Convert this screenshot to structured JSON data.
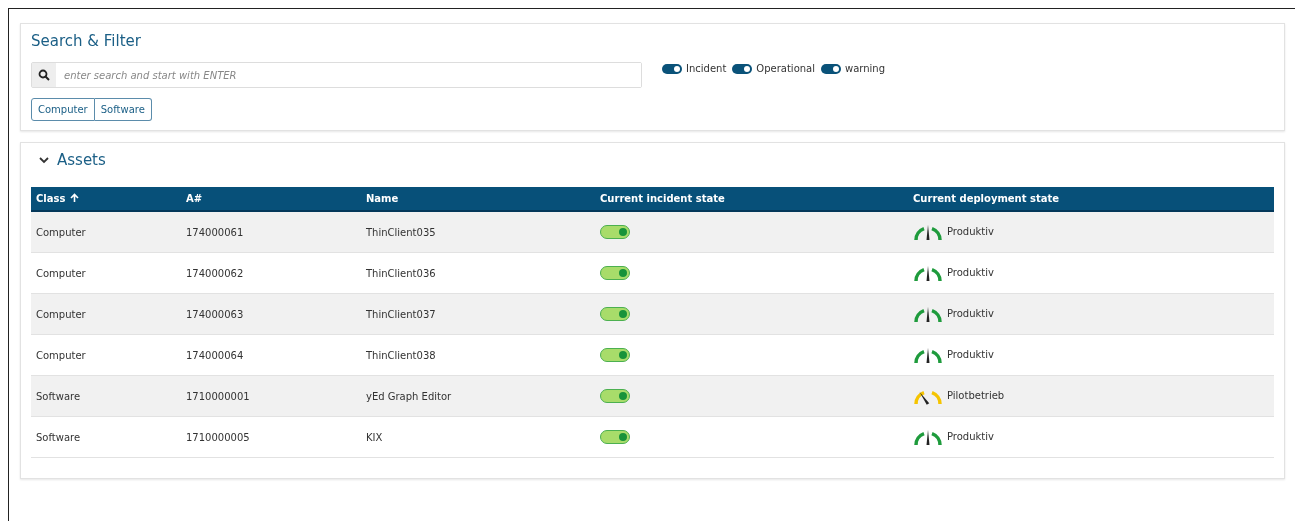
{
  "search_filter": {
    "title": "Search & Filter",
    "search": {
      "placeholder": "enter search and start with ENTER"
    },
    "toggles": [
      {
        "label": "Incident",
        "on": true
      },
      {
        "label": "Operational",
        "on": true
      },
      {
        "label": "warning",
        "on": true
      }
    ],
    "class_buttons": [
      {
        "label": "Computer"
      },
      {
        "label": "Software"
      }
    ]
  },
  "assets": {
    "title": "Assets",
    "expanded": true,
    "columns": [
      {
        "label": "Class",
        "sorted": true
      },
      {
        "label": "A#",
        "sorted": false
      },
      {
        "label": "Name",
        "sorted": false
      },
      {
        "label": "Current incident state",
        "sorted": false
      },
      {
        "label": "Current deployment state",
        "sorted": false
      }
    ],
    "rows": [
      {
        "class": "Computer",
        "number": "174000061",
        "name": "ThinClient035",
        "incident_on": true,
        "deployment": {
          "kind": "productive",
          "color": "#1e9b3c",
          "label": "Produktiv"
        }
      },
      {
        "class": "Computer",
        "number": "174000062",
        "name": "ThinClient036",
        "incident_on": true,
        "deployment": {
          "kind": "productive",
          "color": "#1e9b3c",
          "label": "Produktiv"
        }
      },
      {
        "class": "Computer",
        "number": "174000063",
        "name": "ThinClient037",
        "incident_on": true,
        "deployment": {
          "kind": "productive",
          "color": "#1e9b3c",
          "label": "Produktiv"
        }
      },
      {
        "class": "Computer",
        "number": "174000064",
        "name": "ThinClient038",
        "incident_on": true,
        "deployment": {
          "kind": "productive",
          "color": "#1e9b3c",
          "label": "Produktiv"
        }
      },
      {
        "class": "Software",
        "number": "1710000001",
        "name": "yEd Graph Editor",
        "incident_on": true,
        "deployment": {
          "kind": "pilot",
          "color": "#f5c400",
          "label": "Pilotbetrieb"
        }
      },
      {
        "class": "Software",
        "number": "1710000005",
        "name": "KIX",
        "incident_on": true,
        "deployment": {
          "kind": "productive",
          "color": "#1e9b3c",
          "label": "Produktiv"
        }
      }
    ]
  }
}
